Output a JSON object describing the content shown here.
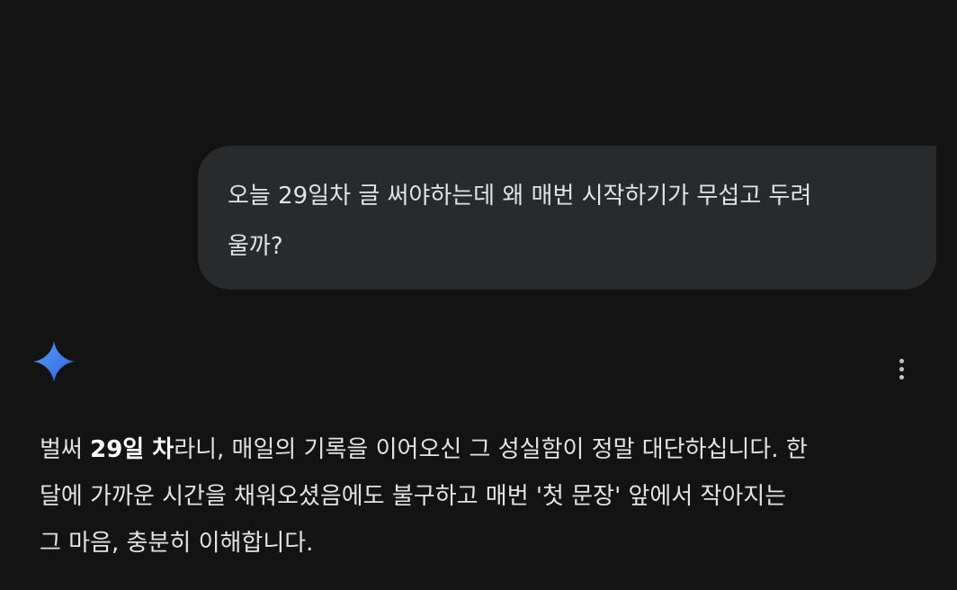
{
  "user_message": {
    "line1": "오늘 29일차 글 써야하는데 왜 매번 시작하기가 무섭고 두려",
    "line2": "울까?"
  },
  "assistant": {
    "logo_icon": "gemini-sparkle-icon",
    "more_icon": "more-vertical-icon",
    "response": {
      "line1_pre": "벌써 ",
      "line1_bold": "29일 차",
      "line1_post": "라니, 매일의 기록을 이어오신 그 성실함이 정말 대단하십니다. 한",
      "line2": "달에 가까운 시간을 채워오셨음에도 불구하고 매번 '첫 문장' 앞에서 작아지는",
      "line3": "그 마음, 충분히 이해합니다."
    }
  },
  "colors": {
    "background": "#131314",
    "bubble": "#282a2c",
    "text": "#e3e3e3",
    "sparkle_start": "#4e8cf5",
    "sparkle_end": "#2f6fe4"
  }
}
